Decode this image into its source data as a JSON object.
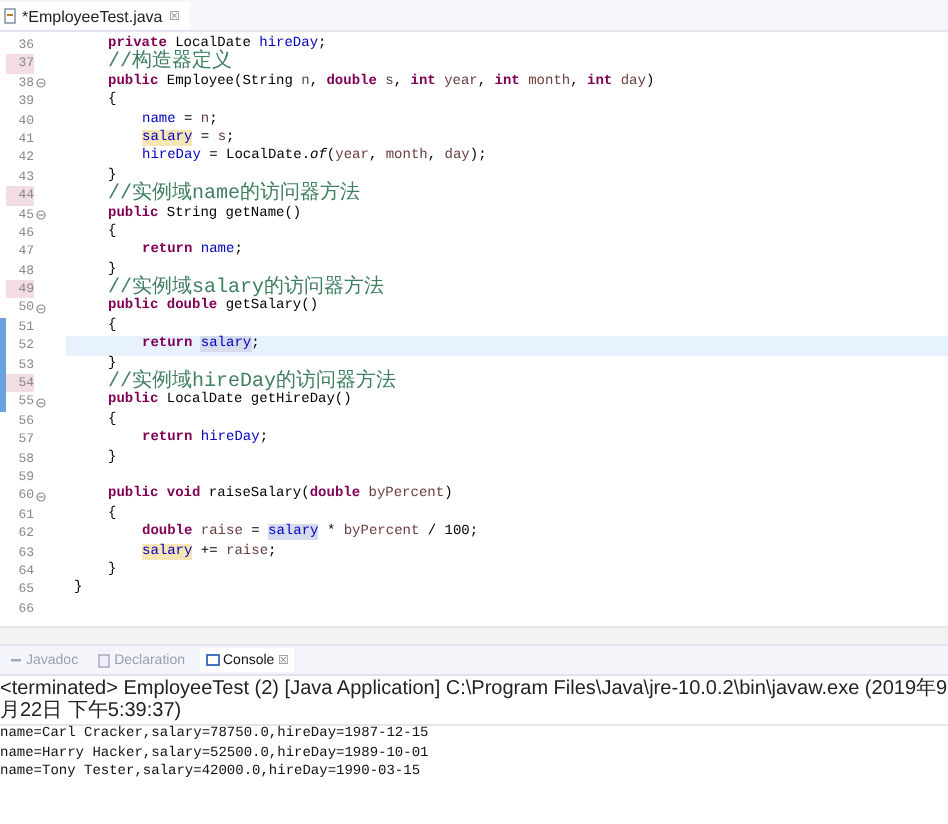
{
  "editor_tab": {
    "label": "*EmployeeTest.java",
    "close": "☒"
  },
  "lines": [
    {
      "number": "36",
      "kind": "member",
      "fold": false,
      "current": false,
      "bookmark": false,
      "tokens": [
        {
          "kind": "kw",
          "text": "private "
        },
        {
          "kind": "plain",
          "text": "LocalDate "
        },
        {
          "kind": "field",
          "text": "hireDay",
          "highlighted": false
        },
        {
          "kind": "plain",
          "text": ";"
        }
      ]
    },
    {
      "number": "37",
      "kind": "member",
      "fold": false,
      "current": false,
      "bookmark": true,
      "tokens": [
        {
          "kind": "comment",
          "text": "//构造器定义"
        }
      ]
    },
    {
      "number": "38",
      "kind": "member",
      "fold": true,
      "current": false,
      "bookmark": false,
      "tokens": [
        {
          "kind": "kw",
          "text": "public "
        },
        {
          "kind": "plain",
          "text": "Employee(String "
        },
        {
          "kind": "param",
          "text": "n"
        },
        {
          "kind": "plain",
          "text": ", "
        },
        {
          "kind": "kw",
          "text": "double "
        },
        {
          "kind": "param",
          "text": "s"
        },
        {
          "kind": "plain",
          "text": ", "
        },
        {
          "kind": "kw",
          "text": "int "
        },
        {
          "kind": "param",
          "text": "year"
        },
        {
          "kind": "plain",
          "text": ", "
        },
        {
          "kind": "kw",
          "text": "int "
        },
        {
          "kind": "param",
          "text": "month"
        },
        {
          "kind": "plain",
          "text": ", "
        },
        {
          "kind": "kw",
          "text": "int "
        },
        {
          "kind": "param",
          "text": "day"
        },
        {
          "kind": "plain",
          "text": ")"
        }
      ]
    },
    {
      "number": "39",
      "kind": "member",
      "fold": false,
      "current": false,
      "bookmark": false,
      "tokens": [
        {
          "kind": "plain",
          "text": "{"
        }
      ]
    },
    {
      "number": "40",
      "kind": "body",
      "fold": false,
      "current": false,
      "bookmark": false,
      "tokens": [
        {
          "kind": "field",
          "text": "name",
          "highlighted": false
        },
        {
          "kind": "plain",
          "text": " = "
        },
        {
          "kind": "param",
          "text": "n"
        },
        {
          "kind": "plain",
          "text": ";"
        }
      ]
    },
    {
      "number": "41",
      "kind": "body",
      "fold": false,
      "current": false,
      "bookmark": false,
      "tokens": [
        {
          "kind": "field",
          "text": "salary",
          "highlighted": true,
          "write": true
        },
        {
          "kind": "plain",
          "text": " = "
        },
        {
          "kind": "param",
          "text": "s"
        },
        {
          "kind": "plain",
          "text": ";"
        }
      ]
    },
    {
      "number": "42",
      "kind": "body",
      "fold": false,
      "current": false,
      "bookmark": false,
      "tokens": [
        {
          "kind": "field",
          "text": "hireDay",
          "highlighted": false
        },
        {
          "kind": "plain",
          "text": " = LocalDate."
        },
        {
          "kind": "static",
          "text": "of"
        },
        {
          "kind": "plain",
          "text": "("
        },
        {
          "kind": "param",
          "text": "year"
        },
        {
          "kind": "plain",
          "text": ", "
        },
        {
          "kind": "param",
          "text": "month"
        },
        {
          "kind": "plain",
          "text": ", "
        },
        {
          "kind": "param",
          "text": "day"
        },
        {
          "kind": "plain",
          "text": ");"
        }
      ]
    },
    {
      "number": "43",
      "kind": "member",
      "fold": false,
      "current": false,
      "bookmark": false,
      "tokens": [
        {
          "kind": "plain",
          "text": "}"
        }
      ]
    },
    {
      "number": "44",
      "kind": "member",
      "fold": false,
      "current": false,
      "bookmark": true,
      "tokens": [
        {
          "kind": "comment",
          "text": "//实例域name的访问器方法"
        }
      ]
    },
    {
      "number": "45",
      "kind": "member",
      "fold": true,
      "current": false,
      "bookmark": false,
      "tokens": [
        {
          "kind": "kw",
          "text": "public "
        },
        {
          "kind": "plain",
          "text": "String getName()"
        }
      ]
    },
    {
      "number": "46",
      "kind": "member",
      "fold": false,
      "current": false,
      "bookmark": false,
      "tokens": [
        {
          "kind": "plain",
          "text": "{"
        }
      ]
    },
    {
      "number": "47",
      "kind": "body",
      "fold": false,
      "current": false,
      "bookmark": false,
      "tokens": [
        {
          "kind": "kw",
          "text": "return "
        },
        {
          "kind": "field",
          "text": "name",
          "highlighted": false
        },
        {
          "kind": "plain",
          "text": ";"
        }
      ]
    },
    {
      "number": "48",
      "kind": "member",
      "fold": false,
      "current": false,
      "bookmark": false,
      "tokens": [
        {
          "kind": "plain",
          "text": "}"
        }
      ]
    },
    {
      "number": "49",
      "kind": "member",
      "fold": false,
      "current": false,
      "bookmark": true,
      "tokens": [
        {
          "kind": "comment",
          "text": "//实例域salary的访问器方法"
        }
      ]
    },
    {
      "number": "50",
      "kind": "member",
      "fold": true,
      "current": false,
      "bookmark": false,
      "tokens": [
        {
          "kind": "kw",
          "text": "public double "
        },
        {
          "kind": "plain",
          "text": "getSalary()"
        }
      ]
    },
    {
      "number": "51",
      "kind": "member",
      "fold": false,
      "current": false,
      "bookmark": false,
      "tokens": [
        {
          "kind": "plain",
          "text": "{"
        }
      ]
    },
    {
      "number": "52",
      "kind": "body",
      "fold": false,
      "current": true,
      "bookmark": false,
      "tokens": [
        {
          "kind": "kw",
          "text": "return "
        },
        {
          "kind": "field",
          "text": "salary",
          "highlighted": true,
          "write": false
        },
        {
          "kind": "plain",
          "text": ";"
        }
      ]
    },
    {
      "number": "53",
      "kind": "member",
      "fold": false,
      "current": false,
      "bookmark": false,
      "tokens": [
        {
          "kind": "plain",
          "text": "}"
        }
      ]
    },
    {
      "number": "54",
      "kind": "member",
      "fold": false,
      "current": false,
      "bookmark": true,
      "tokens": [
        {
          "kind": "comment",
          "text": "//实例域hireDay的访问器方法"
        }
      ]
    },
    {
      "number": "55",
      "kind": "member",
      "fold": true,
      "current": false,
      "bookmark": false,
      "tokens": [
        {
          "kind": "kw",
          "text": "public "
        },
        {
          "kind": "plain",
          "text": "LocalDate getHireDay()"
        }
      ]
    },
    {
      "number": "56",
      "kind": "member",
      "fold": false,
      "current": false,
      "bookmark": false,
      "tokens": [
        {
          "kind": "plain",
          "text": "{"
        }
      ]
    },
    {
      "number": "57",
      "kind": "body",
      "fold": false,
      "current": false,
      "bookmark": false,
      "tokens": [
        {
          "kind": "kw",
          "text": "return "
        },
        {
          "kind": "field",
          "text": "hireDay",
          "highlighted": false
        },
        {
          "kind": "plain",
          "text": ";"
        }
      ]
    },
    {
      "number": "58",
      "kind": "member",
      "fold": false,
      "current": false,
      "bookmark": false,
      "tokens": [
        {
          "kind": "plain",
          "text": "}"
        }
      ]
    },
    {
      "number": "59",
      "fold": false,
      "current": false,
      "bookmark": false
    },
    {
      "number": "60",
      "kind": "member",
      "fold": true,
      "current": false,
      "bookmark": false,
      "tokens": [
        {
          "kind": "kw",
          "text": "public void "
        },
        {
          "kind": "plain",
          "text": "raiseSalary("
        },
        {
          "kind": "kw",
          "text": "double "
        },
        {
          "kind": "param",
          "text": "byPercent"
        },
        {
          "kind": "plain",
          "text": ")"
        }
      ]
    },
    {
      "number": "61",
      "kind": "member",
      "fold": false,
      "current": false,
      "bookmark": false,
      "tokens": [
        {
          "kind": "plain",
          "text": "{"
        }
      ]
    },
    {
      "number": "62",
      "kind": "body",
      "fold": false,
      "current": false,
      "bookmark": false,
      "tokens": [
        {
          "kind": "kw",
          "text": "double "
        },
        {
          "kind": "local",
          "text": "raise"
        },
        {
          "kind": "plain",
          "text": " = "
        },
        {
          "kind": "field",
          "text": "salary",
          "highlighted": true,
          "write": false
        },
        {
          "kind": "plain",
          "text": " * "
        },
        {
          "kind": "param",
          "text": "byPercent"
        },
        {
          "kind": "plain",
          "text": " / 100;"
        }
      ]
    },
    {
      "number": "63",
      "kind": "body",
      "fold": false,
      "current": false,
      "bookmark": false,
      "tokens": [
        {
          "kind": "field",
          "text": "salary",
          "highlighted": true,
          "write": true
        },
        {
          "kind": "plain",
          "text": " += "
        },
        {
          "kind": "local",
          "text": "raise"
        },
        {
          "kind": "plain",
          "text": ";"
        }
      ]
    },
    {
      "number": "64",
      "kind": "member",
      "fold": false,
      "current": false,
      "bookmark": false,
      "tokens": [
        {
          "kind": "plain",
          "text": "}"
        }
      ]
    },
    {
      "number": "65",
      "kind": "class",
      "fold": false,
      "current": false,
      "bookmark": false,
      "tokens": [
        {
          "kind": "plain",
          "text": "}"
        }
      ]
    },
    {
      "number": "66",
      "fold": false,
      "current": false,
      "bookmark": false
    }
  ],
  "view_tabs": [
    {
      "label": "Javadoc",
      "selected": false,
      "kind": "javadoc"
    },
    {
      "label": "Declaration",
      "selected": false,
      "kind": "declaration"
    },
    {
      "label": "Console",
      "selected": true,
      "kind": "console",
      "close": "☒"
    }
  ],
  "console": {
    "header": "<terminated> EmployeeTest (2) [Java Application] C:\\Program Files\\Java\\jre-10.0.2\\bin\\javaw.exe (2019年9月22日 下午5:39:37)",
    "output": [
      "name=Carl Cracker,salary=78750.0,hireDay=1987-12-15",
      "name=Harry Hacker,salary=52500.0,hireDay=1989-10-01",
      "name=Tony Tester,salary=42000.0,hireDay=1990-03-15"
    ]
  }
}
